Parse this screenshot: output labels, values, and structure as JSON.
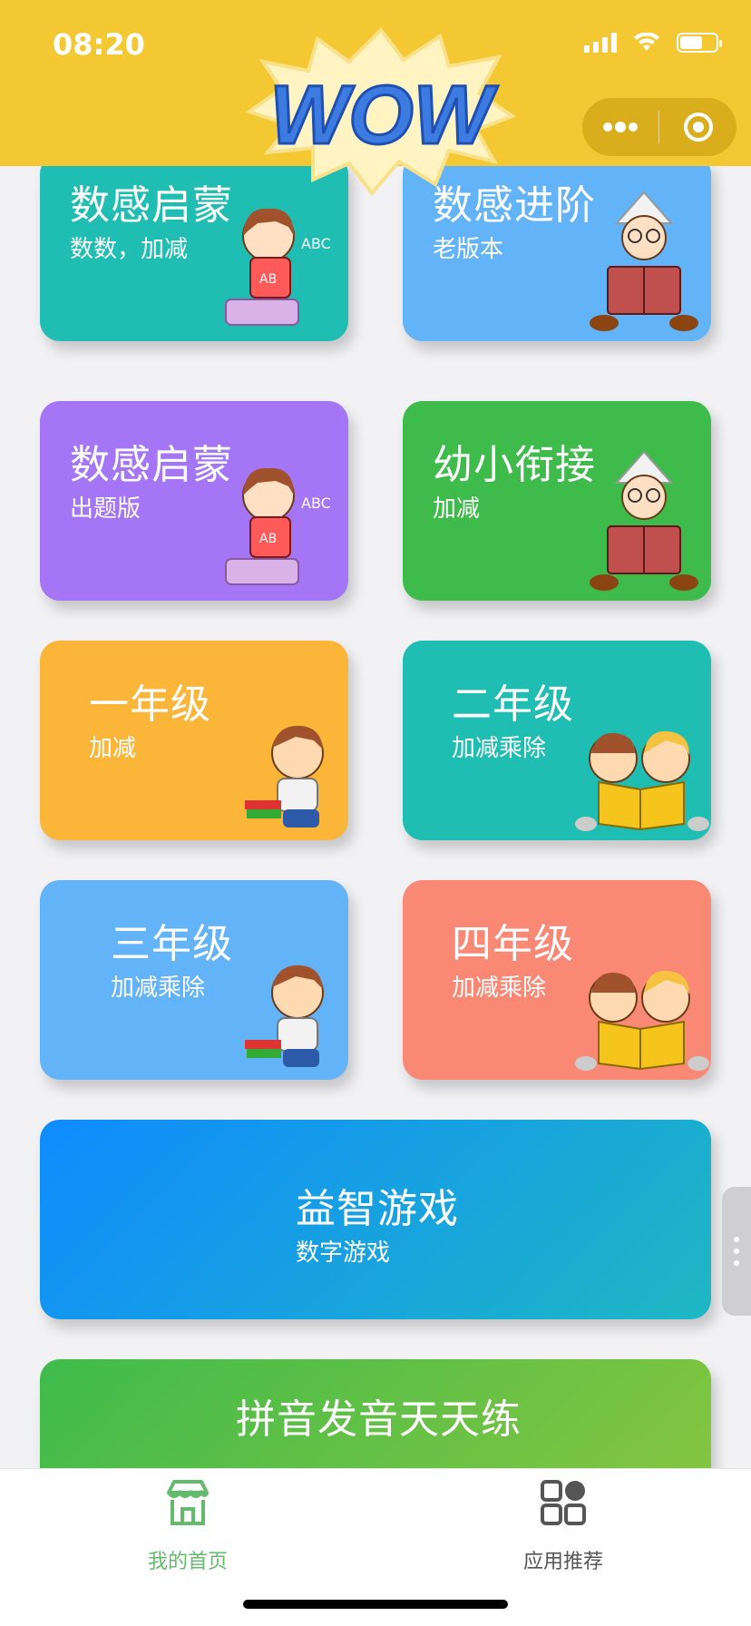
{
  "status_bar": {
    "time": "08:20"
  },
  "header": {
    "logo_text": "WOW",
    "background": "#f4c832"
  },
  "capsule": {
    "more_icon": "more-dots-icon",
    "close_icon": "target-icon"
  },
  "cards": [
    {
      "title": "数感启蒙",
      "sub": "数数，加减",
      "color": "#1fbdb2",
      "art": "girl-reading"
    },
    {
      "title": "数感进阶",
      "sub": "老版本",
      "color": "#62b3f7",
      "art": "boy-with-paper-hat"
    },
    {
      "title": "数感启蒙",
      "sub": "出题版",
      "color": "#a475f5",
      "art": "girl-reading"
    },
    {
      "title": "幼小衔接",
      "sub": "加减",
      "color": "#3fbb4c",
      "art": "boy-with-paper-hat"
    },
    {
      "title": "一年级",
      "sub": "加减",
      "color": "#fbb63a",
      "art": "boy-with-books"
    },
    {
      "title": "二年级",
      "sub": "加减乘除",
      "color": "#1fbdb2",
      "art": "two-kids-reading"
    },
    {
      "title": "三年级",
      "sub": "加减乘除",
      "color": "#62b3f7",
      "art": "boy-with-books"
    },
    {
      "title": "四年级",
      "sub": "加减乘除",
      "color": "#f98975",
      "art": "two-kids-reading"
    }
  ],
  "wide_cards": [
    {
      "title": "益智游戏",
      "sub": "数字游戏"
    },
    {
      "title": "拼音发音天天练"
    }
  ],
  "tabs": [
    {
      "label": "我的首页",
      "icon": "storefront-icon",
      "color": "#62bb6b"
    },
    {
      "label": "应用推荐",
      "icon": "grid-apps-icon",
      "color": "#555555"
    }
  ]
}
